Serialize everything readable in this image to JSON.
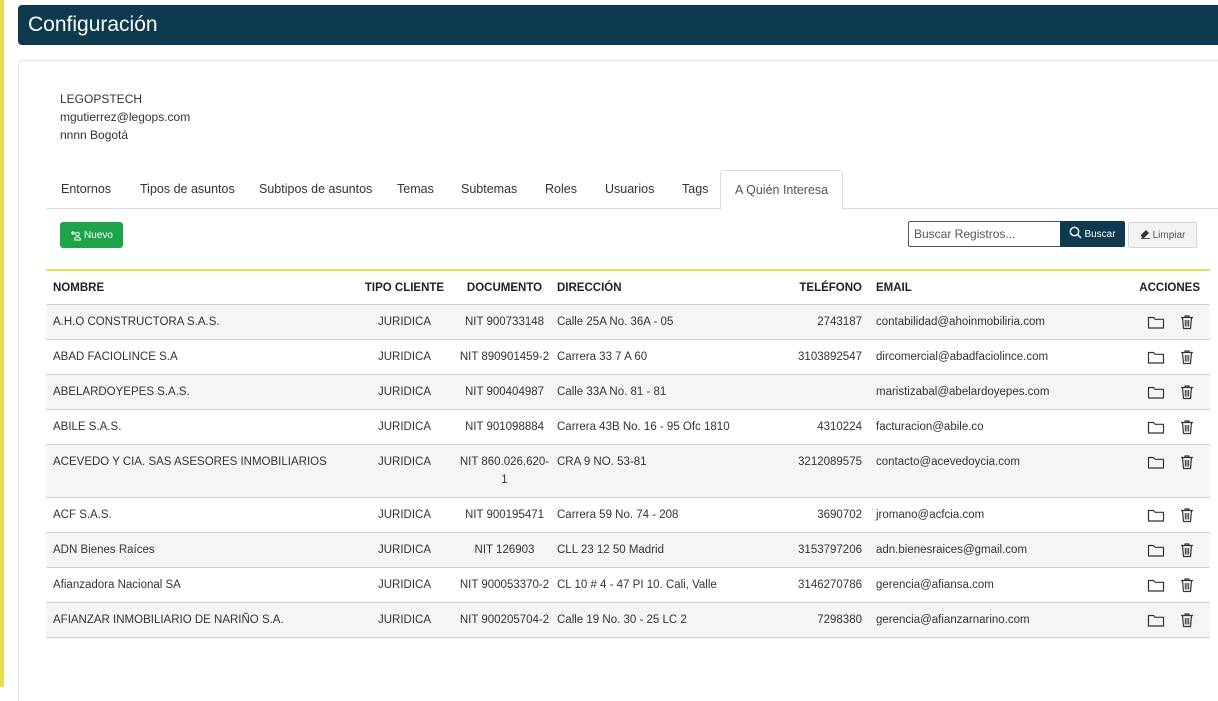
{
  "header": {
    "title": "Configuración"
  },
  "company": {
    "name": "LEGOPSTECH",
    "email": "mgutierrez@legops.com",
    "location": "nnnn Bogotá"
  },
  "tabs": [
    {
      "label": "Entornos"
    },
    {
      "label": "Tipos de asuntos"
    },
    {
      "label": "Subtipos de asuntos"
    },
    {
      "label": "Temas"
    },
    {
      "label": "Subtemas"
    },
    {
      "label": "Roles"
    },
    {
      "label": "Usuarios"
    },
    {
      "label": "Tags"
    },
    {
      "label": "A Quién Interesa",
      "active": true
    }
  ],
  "toolbar": {
    "new_label": "Nuevo",
    "search_placeholder": "Buscar Registros...",
    "search_label": "Buscar",
    "clear_label": "Limpiar"
  },
  "table": {
    "headers": {
      "nombre": "NOMBRE",
      "tipo": "TIPO CLIENTE",
      "documento": "DOCUMENTO",
      "direccion": "DIRECCIÓN",
      "telefono": "TELÉFONO",
      "email": "EMAIL",
      "acciones": "ACCIONES"
    },
    "rows": [
      {
        "nombre": "A.H.O CONSTRUCTORA S.A.S.",
        "tipo": "JURIDICA",
        "documento": "NIT 900733148",
        "direccion": "Calle 25A No. 36A - 05",
        "telefono": "2743187",
        "email": "contabilidad@ahoinmobiliria.com"
      },
      {
        "nombre": "ABAD FACIOLINCE S.A",
        "tipo": "JURIDICA",
        "documento": "NIT 890901459-2",
        "direccion": "Carrera 33 7 A 60",
        "telefono": "3103892547",
        "email": "dircomercial@abadfaciolince.com"
      },
      {
        "nombre": "ABELARDOYEPES S.A.S.",
        "tipo": "JURIDICA",
        "documento": "NIT 900404987",
        "direccion": "Calle 33A No. 81 - 81",
        "telefono": "",
        "email": "maristizabal@abelardoyepes.com"
      },
      {
        "nombre": "ABILE S.A.S.",
        "tipo": "JURIDICA",
        "documento": "NIT 901098884",
        "direccion": "Carrera 43B No. 16 - 95 Ofc 1810",
        "telefono": "4310224",
        "email": "facturacion@abile.co"
      },
      {
        "nombre": "ACEVEDO Y CIA. SAS ASESORES INMOBILIARIOS",
        "tipo": "JURIDICA",
        "documento": "NIT 860.026.620-1",
        "direccion": "CRA 9 NO. 53-81",
        "telefono": "3212089575",
        "email": "contacto@acevedoycia.com"
      },
      {
        "nombre": "ACF S.A.S.",
        "tipo": "JURIDICA",
        "documento": "NIT 900195471",
        "direccion": "Carrera 59 No. 74 - 208",
        "telefono": "3690702",
        "email": "jromano@acfcia.com"
      },
      {
        "nombre": "ADN Bienes Raíces",
        "tipo": "JURIDICA",
        "documento": "NIT 126903",
        "direccion": "CLL 23 12 50 Madrid",
        "telefono": "3153797206",
        "email": "adn.bienesraices@gmail.com"
      },
      {
        "nombre": "Afianzadora Nacional SA",
        "tipo": "JURIDICA",
        "documento": "NIT 900053370-2",
        "direccion": "CL 10 # 4 - 47 PI 10. Cali, Valle",
        "telefono": "3146270786",
        "email": "gerencia@afiansa.com"
      },
      {
        "nombre": "AFIANZAR INMOBILIARIO DE NARIÑO S.A.",
        "tipo": "JURIDICA",
        "documento": "NIT 900205704-2",
        "direccion": "Calle 19 No. 30 - 25 LC 2",
        "telefono": "7298380",
        "email": "gerencia@afianzarnarino.com"
      }
    ]
  },
  "icons": {
    "new": "add-user-icon",
    "search": "search-icon",
    "clear": "eraser-icon",
    "folder": "folder-icon",
    "trash": "trash-icon"
  },
  "colors": {
    "header_bg": "#0d3a4f",
    "accent_yellow": "#e3e04b",
    "new_button": "#1fa34a",
    "search_button": "#0d3a4f"
  }
}
